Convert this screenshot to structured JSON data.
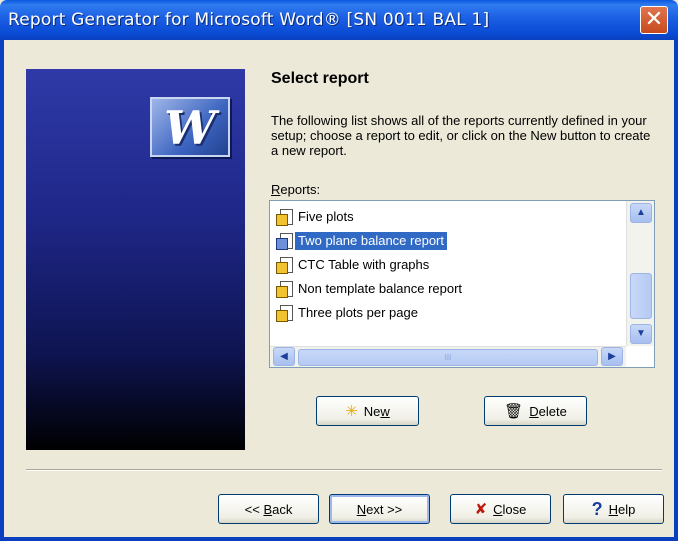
{
  "window": {
    "title": "Report Generator for Microsoft Word® [SN 0011 BAL 1]",
    "close_glyph": "✕"
  },
  "logo": {
    "letter": "W"
  },
  "page": {
    "heading": "Select report",
    "description": "The following list shows all of the reports currently defined in your setup; choose a report to edit, or click on the New button to create a new report.",
    "reports_label_mnemonic": "R",
    "reports_label_rest": "eports:"
  },
  "reports": {
    "items": [
      {
        "label": "Five plots",
        "icon": "report-doc-icon"
      },
      {
        "label": "Two plane balance report",
        "icon": "report-doc-icon-blue",
        "selected": true
      },
      {
        "label": "CTC Table with graphs",
        "icon": "report-doc-icon"
      },
      {
        "label": "Non template balance report",
        "icon": "report-doc-icon"
      },
      {
        "label": "Three plots per page",
        "icon": "report-doc-icon"
      }
    ]
  },
  "scrollbar": {
    "up": "▲",
    "down": "▼",
    "left": "◀",
    "right": "▶",
    "grip": "III"
  },
  "buttons": {
    "new": {
      "icon": "✳",
      "mnemonic": "",
      "label_pre": "Ne",
      "label_u": "w"
    },
    "delete": {
      "icon": "🗑",
      "label_u": "D",
      "label_post": "elete"
    },
    "back": {
      "pre": "<< ",
      "u": "B",
      "post": "ack"
    },
    "next": {
      "u": "N",
      "post": "ext >>"
    },
    "close": {
      "icon": "✘",
      "u": "C",
      "post": "lose"
    },
    "help": {
      "icon": "?",
      "u": "H",
      "post": "elp"
    }
  },
  "colors": {
    "selection": "#316AC5",
    "titlebar": "#0A58E0",
    "face": "#ECE9D8"
  }
}
